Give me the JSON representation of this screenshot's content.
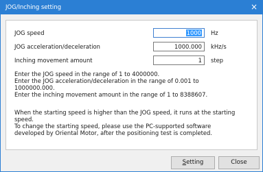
{
  "window": {
    "title": "JOG/Inching setting",
    "close_glyph": "×"
  },
  "fields": {
    "jog_speed": {
      "label": "JOG speed",
      "value": "1000",
      "unit": "Hz"
    },
    "jog_accel": {
      "label": "JOG acceleration/deceleration",
      "value": "1000.000",
      "unit": "kHz/s"
    },
    "inching": {
      "label": "Inching movement amount",
      "value": "1",
      "unit": "step"
    }
  },
  "info": {
    "line1": "Enter the JOG speed in the range of 1 to 4000000.",
    "line2": "Enter the JOG acceleration/deceleration in the range of 0.001 to",
    "line3": "1000000.000.",
    "line4": "Enter the inching movement amount in the range of 1 to 8388607."
  },
  "note": {
    "line1": "When the starting speed is higher than the JOG speed, it runs at the starting",
    "line2": "speed.",
    "line3": "To change the starting speed, please use the PC-supported software",
    "line4": "developed by Oriental Motor, after the positioning test is completed."
  },
  "buttons": {
    "setting_first": "S",
    "setting_rest": "etting",
    "close": "Close"
  },
  "colors": {
    "title_bar": "#2b7fd4",
    "selection": "#3399ff"
  }
}
